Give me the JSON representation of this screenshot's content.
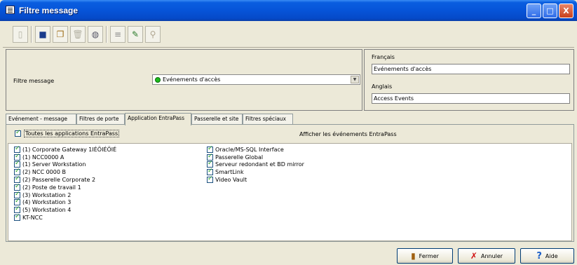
{
  "window": {
    "title": "Filtre message",
    "controls": [
      "_",
      "□",
      "X"
    ]
  },
  "toolbar": {
    "icons": [
      "new-icon",
      "save-icon",
      "copy-icon",
      "delete-icon",
      "print-icon",
      "list-icon",
      "brush-icon",
      "find-icon"
    ],
    "glyphs": {
      "new": "▯",
      "save": "■",
      "copy": "❐",
      "delete": "🗑",
      "print": "◍",
      "list": "≡",
      "brush": "✎",
      "find": "⚲"
    }
  },
  "filter": {
    "label": "Filtre message",
    "value": "Evénements d'accès",
    "status_color": "#1dbb1d"
  },
  "languages": {
    "french_label": "Français",
    "french_value": "Evénements d'accès",
    "english_label": "Anglais",
    "english_value": "Access Events"
  },
  "tabs": [
    {
      "label": "Evénement - message",
      "active": false
    },
    {
      "label": "Filtres de porte",
      "active": false
    },
    {
      "label": "Application EntraPass",
      "active": true
    },
    {
      "label": "Passerelle et site",
      "active": false
    },
    {
      "label": "Filtres spéciaux",
      "active": false
    }
  ],
  "panel": {
    "all_apps_label": "Toutes les applications EntraPass",
    "all_apps_checked": true,
    "show_events_label": "Afficher les événements EntraPass"
  },
  "apps_left": [
    {
      "label": "(1) Corporate Gateway 1IÉÖIÉÖIÉ",
      "checked": true
    },
    {
      "label": "(1) NCC0000 A",
      "checked": true
    },
    {
      "label": "(1) Server Workstation",
      "checked": true
    },
    {
      "label": "(2) NCC 0000 B",
      "checked": true
    },
    {
      "label": "(2) Passerelle Corporate 2",
      "checked": true
    },
    {
      "label": "(2) Poste de travail 1",
      "checked": true
    },
    {
      "label": "(3) Workstation 2",
      "checked": true
    },
    {
      "label": "(4) Workstation 3",
      "checked": true
    },
    {
      "label": "(5) Workstation 4",
      "checked": true
    },
    {
      "label": "KT-NCC",
      "checked": true
    }
  ],
  "apps_right": [
    {
      "label": "Oracle/MS-SQL Interface",
      "checked": true
    },
    {
      "label": "Passerelle Global",
      "checked": true
    },
    {
      "label": "Serveur redondant et BD mirror",
      "checked": true
    },
    {
      "label": "SmartLink",
      "checked": true
    },
    {
      "label": "Video Vault",
      "checked": true
    }
  ],
  "buttons": {
    "close_label": "Fermer",
    "cancel_label": "Annuler",
    "help_label": "Aide"
  }
}
